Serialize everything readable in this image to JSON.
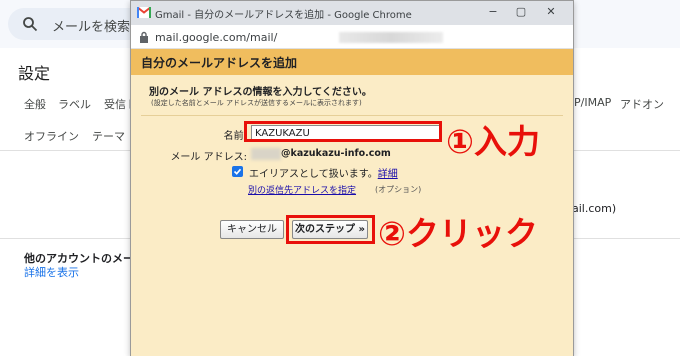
{
  "background": {
    "search_placeholder": "メールを検索",
    "settings_title": "設定",
    "tabs": [
      "全般",
      "ラベル",
      "受信ト",
      "P/IMAP",
      "アドオン"
    ],
    "tabs_row2": [
      "オフライン",
      "テーマ"
    ],
    "other_accounts_label": "他のアカウントのメー",
    "show_details": "詳細を表示",
    "partial_text": "ail.com)"
  },
  "window": {
    "title": "Gmail - 自分のメールアドレスを追加 - Google Chrome",
    "url": "mail.google.com/mail/",
    "minimize": "−",
    "maximize": "▢",
    "close": "✕"
  },
  "dialog": {
    "title": "自分のメールアドレスを追加",
    "heading": "別のメール アドレスの情報を入力してください。",
    "subtext": "(設定した名前とメール アドレスが送信するメールに表示されます)",
    "name_label": "名前:",
    "name_value": "KAZUKAZU",
    "email_label": "メール アドレス:",
    "email_value": "@kazukazu-info.com",
    "alias_text": "エイリアスとして扱います。",
    "alias_link": "詳細",
    "alias_checked": true,
    "reply_link": "別の返信先アドレスを指定",
    "reply_optional": "(オプション)",
    "cancel_label": "キャンセル",
    "next_label": "次のステップ »"
  },
  "annotations": {
    "step1": "①入力",
    "step2": "②クリック",
    "color": "#e8100a"
  }
}
